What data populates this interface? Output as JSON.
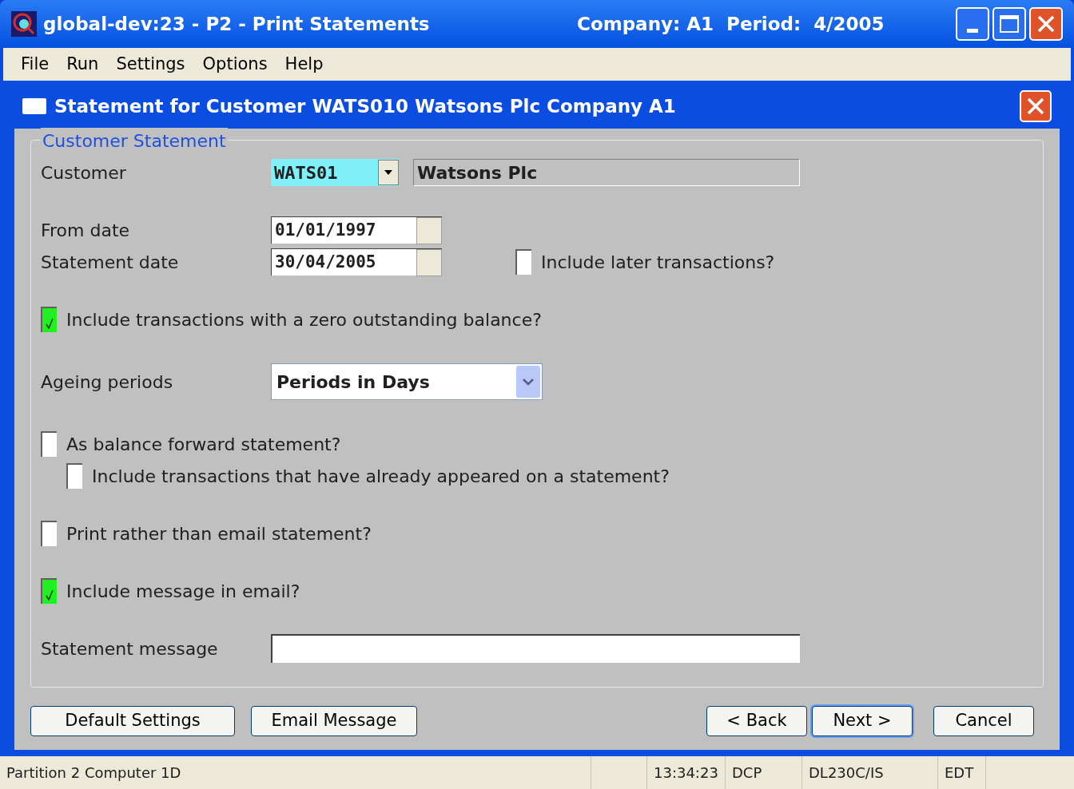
{
  "window": {
    "title": "global-dev:23 - P2 - Print Statements",
    "info": "Company: A1  Period:  4/2005"
  },
  "menu": [
    "File",
    "Run",
    "Settings",
    "Options",
    "Help"
  ],
  "dialog": {
    "title": "Statement for Customer WATS010 Watsons Plc Company A1"
  },
  "group": {
    "title": "Customer Statement"
  },
  "customer": {
    "label": "Customer",
    "code": "WATS01",
    "name": "Watsons Plc"
  },
  "from_date": {
    "label": "From date",
    "value": "01/01/1997"
  },
  "statement_date": {
    "label": "Statement date",
    "value": "30/04/2005"
  },
  "include_later": {
    "label": "Include later transactions?",
    "checked": false
  },
  "zero_balance": {
    "label": "Include transactions with a zero outstanding balance?",
    "checked": true
  },
  "ageing": {
    "label": "Ageing periods",
    "value": "Periods in Days"
  },
  "balance_forward": {
    "label": "As balance forward statement?",
    "checked": false,
    "children": [
      {
        "label": "Include transactions that have already appeared on a statement?",
        "checked": false
      }
    ]
  },
  "print_rather": {
    "label": "Print rather than email statement?",
    "checked": false
  },
  "include_message": {
    "label": "Include message in email?",
    "checked": true
  },
  "message": {
    "label": "Statement message"
  },
  "buttons_left": [
    "Default Settings",
    "Email Message"
  ],
  "buttons_right": [
    {
      "label": "< Back",
      "default": false
    },
    {
      "label": "Next >",
      "default": true
    },
    {
      "label": "Cancel",
      "default": false
    }
  ],
  "status_bar": [
    "Partition 2 Computer 1D",
    "13:34:23",
    "DCP",
    "DL230C/IS",
    "EDT"
  ]
}
